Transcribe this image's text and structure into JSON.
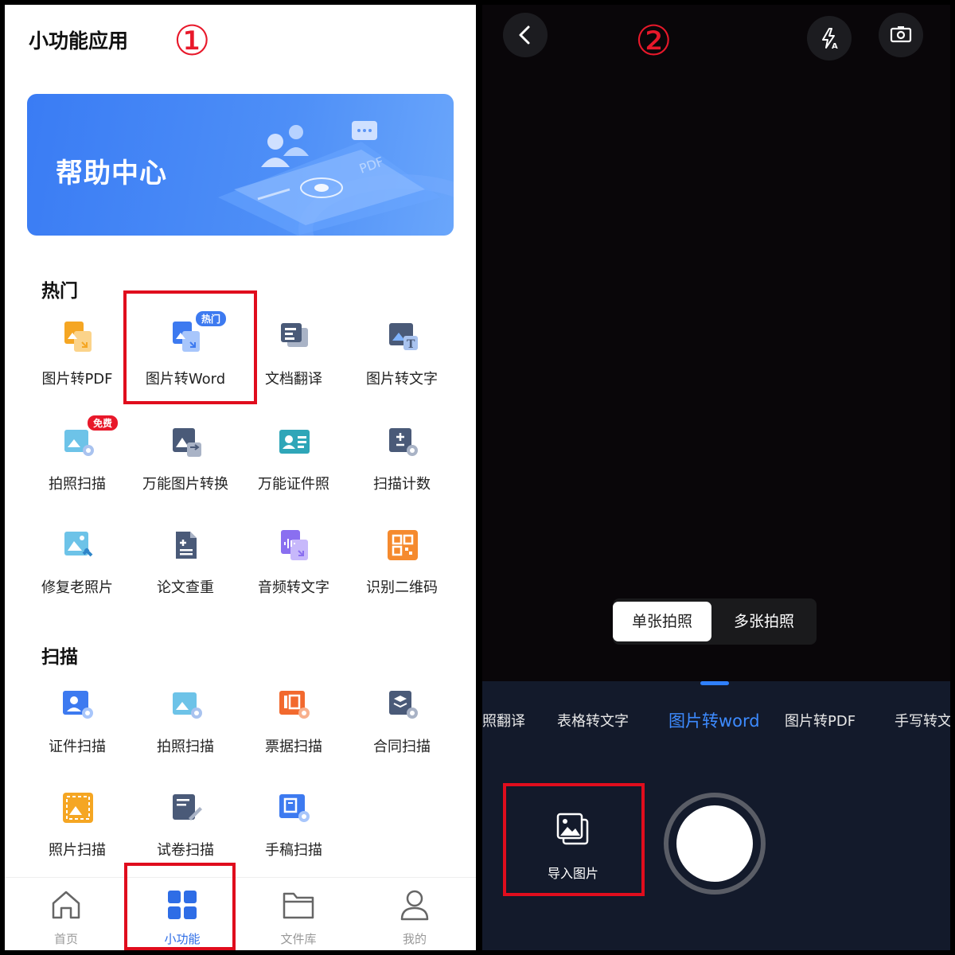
{
  "left": {
    "page_title": "小功能应用",
    "step_marker": "①",
    "banner": {
      "title": "帮助中心",
      "decor_text": "PDF"
    },
    "sections": [
      {
        "title": "热门"
      },
      {
        "title": "扫描"
      }
    ],
    "hot_items": [
      {
        "label": "图片转PDF",
        "icon": "image-to-pdf-icon"
      },
      {
        "label": "图片转Word",
        "icon": "image-to-word-icon",
        "badge": "热门"
      },
      {
        "label": "文档翻译",
        "icon": "doc-translate-icon"
      },
      {
        "label": "图片转文字",
        "icon": "image-to-text-icon"
      },
      {
        "label": "拍照扫描",
        "icon": "photo-scan-icon",
        "badge": "免费"
      },
      {
        "label": "万能图片转换",
        "icon": "image-convert-icon"
      },
      {
        "label": "万能证件照",
        "icon": "id-photo-icon"
      },
      {
        "label": "扫描计数",
        "icon": "scan-count-icon"
      },
      {
        "label": "修复老照片",
        "icon": "repair-photo-icon"
      },
      {
        "label": "论文查重",
        "icon": "paper-check-icon"
      },
      {
        "label": "音频转文字",
        "icon": "audio-to-text-icon"
      },
      {
        "label": "识别二维码",
        "icon": "qr-code-icon"
      }
    ],
    "scan_items": [
      {
        "label": "证件扫描",
        "icon": "id-scan-icon"
      },
      {
        "label": "拍照扫描",
        "icon": "photo-scan-icon"
      },
      {
        "label": "票据扫描",
        "icon": "receipt-scan-icon"
      },
      {
        "label": "合同扫描",
        "icon": "contract-scan-icon"
      },
      {
        "label": "照片扫描",
        "icon": "photo-image-scan-icon"
      },
      {
        "label": "试卷扫描",
        "icon": "exam-scan-icon"
      },
      {
        "label": "手稿扫描",
        "icon": "manuscript-scan-icon"
      }
    ],
    "bottom_nav": [
      {
        "label": "首页",
        "icon": "home-icon"
      },
      {
        "label": "小功能",
        "icon": "grid-icon",
        "active": true
      },
      {
        "label": "文件库",
        "icon": "folder-icon"
      },
      {
        "label": "我的",
        "icon": "user-icon"
      }
    ]
  },
  "right": {
    "step_marker": "②",
    "mode_switch": {
      "single": "单张拍照",
      "multi": "多张拍照",
      "selected": "单张拍照"
    },
    "tool_tabs": [
      {
        "label": "拍照翻译"
      },
      {
        "label": "表格转文字"
      },
      {
        "label": "图片转word",
        "active": true
      },
      {
        "label": "图片转PDF"
      },
      {
        "label": "手写转文字"
      }
    ],
    "import_button": {
      "label": "导入图片",
      "icon": "gallery-icon"
    }
  },
  "colors": {
    "accent_blue": "#2e6de6",
    "highlight_red": "#e00d1d",
    "camera_bg": "#090609",
    "toolbar_bg": "#131a2b",
    "active_tab_blue": "#3d8bff"
  }
}
